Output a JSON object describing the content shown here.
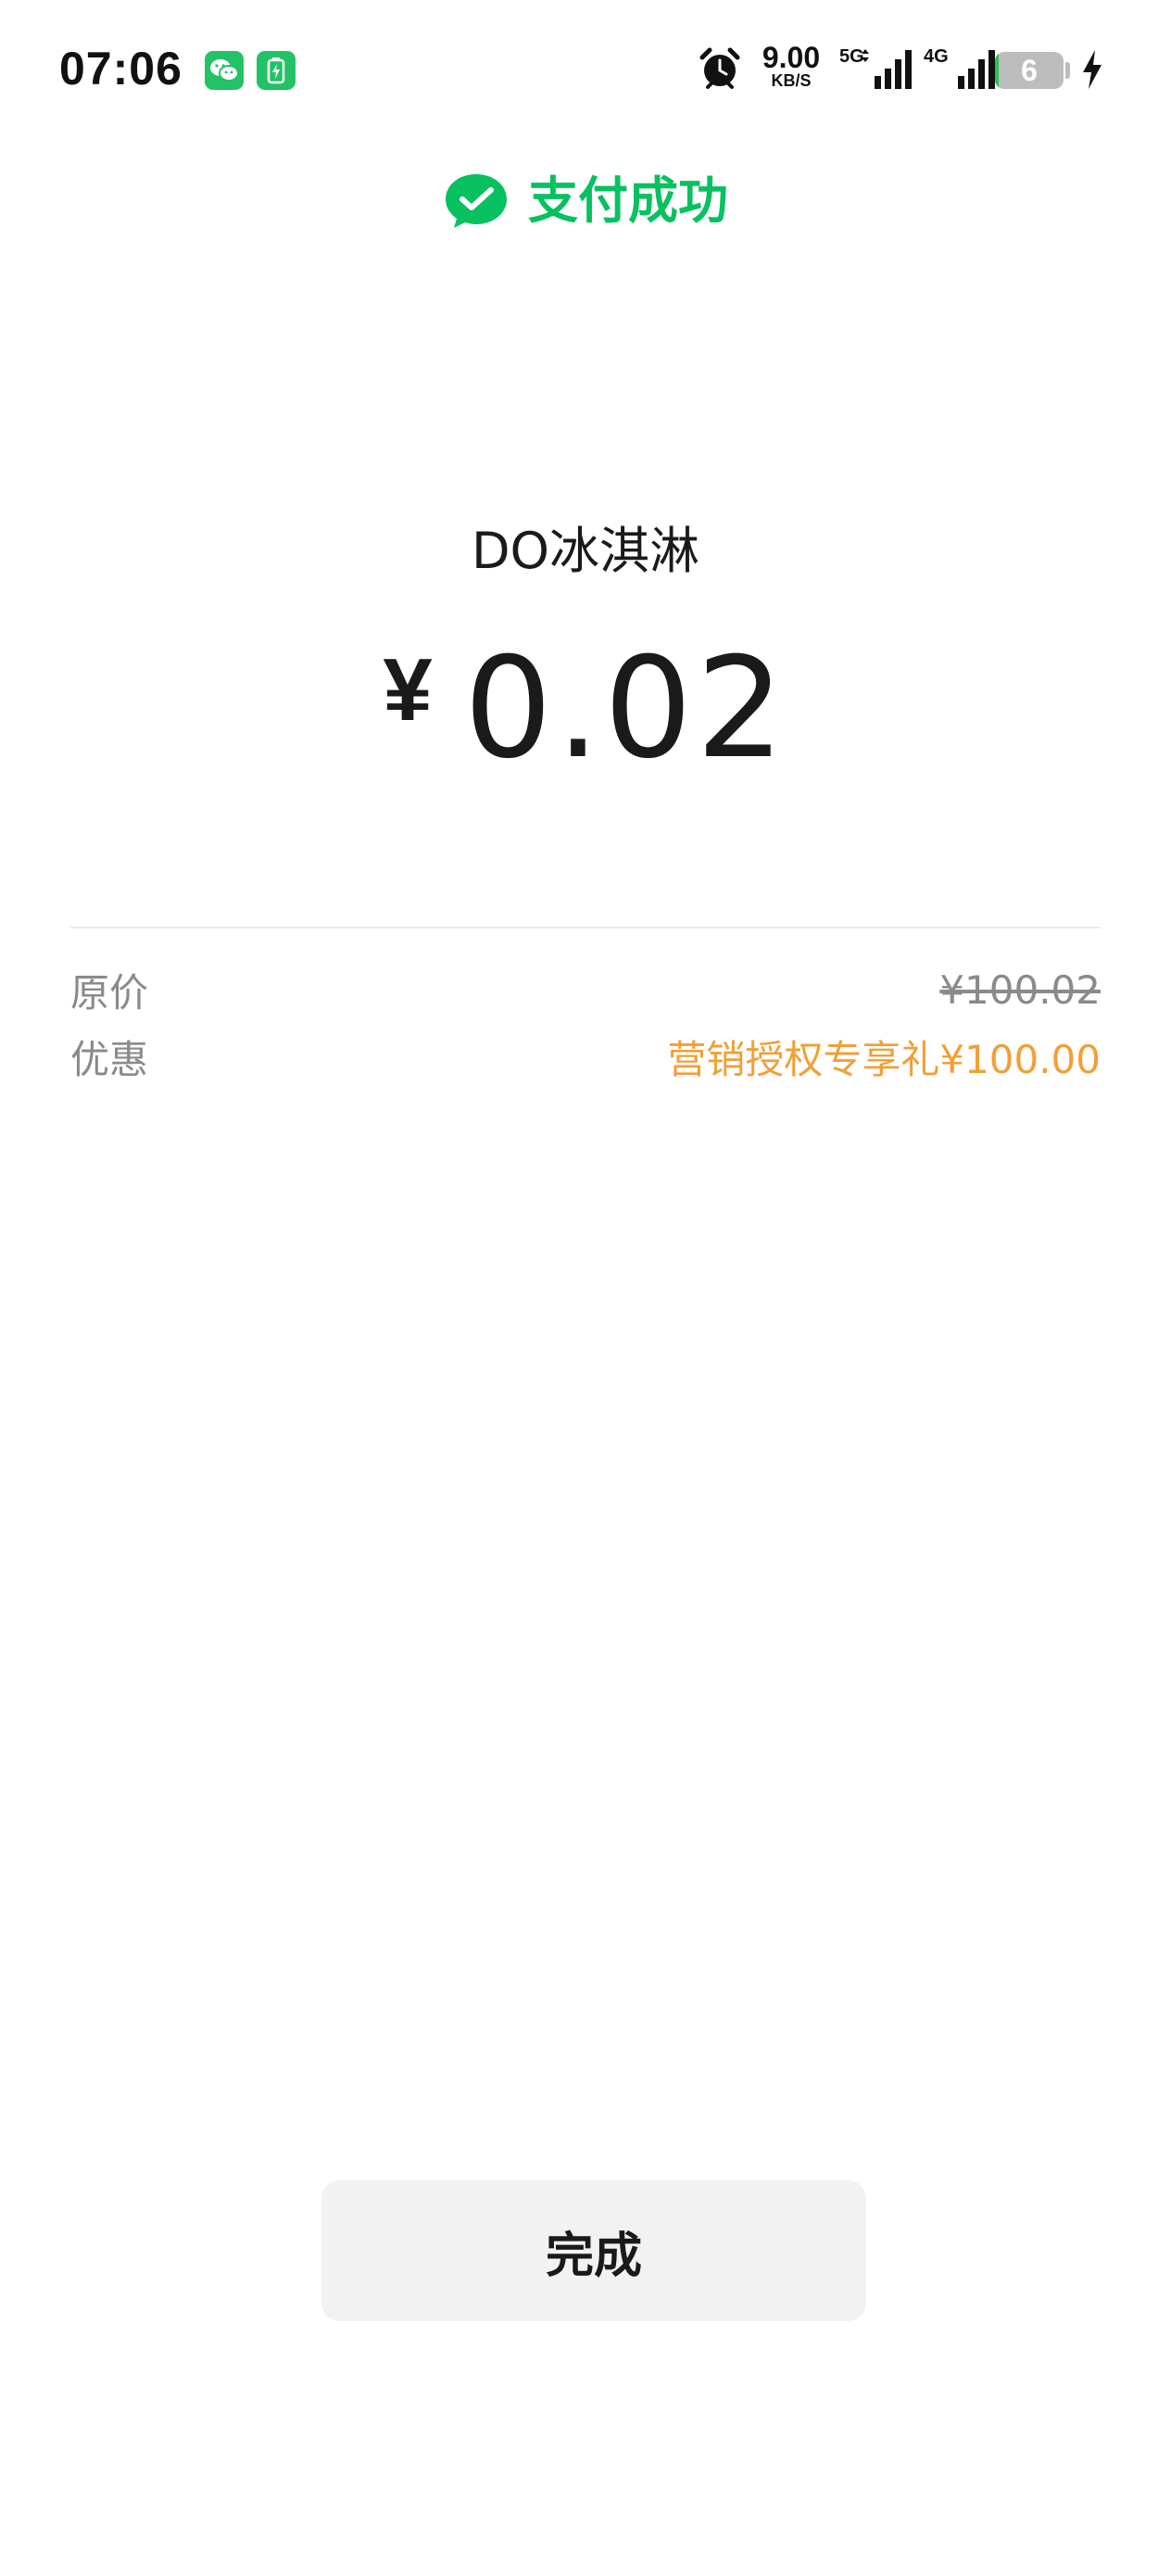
{
  "status_bar": {
    "time": "07:06",
    "net_speed_value": "9.00",
    "net_speed_unit": "KB/S",
    "signal_1_label": "5G",
    "signal_2_label": "4G",
    "battery_level": "6",
    "battery_fraction": 0.06,
    "icons": [
      "wechat-icon",
      "battery-saver-icon",
      "alarm-icon",
      "signal-icon",
      "charging-icon"
    ]
  },
  "header": {
    "status_text": "支付成功",
    "accent_color": "#07c160"
  },
  "payment": {
    "merchant": "DO冰淇淋",
    "currency_symbol": "¥",
    "amount": "0.02"
  },
  "details": {
    "original_label": "原价",
    "original_value": "¥100.02",
    "discount_label": "优惠",
    "discount_value": "营销授权专享礼¥100.00",
    "discount_color": "#f0a037"
  },
  "actions": {
    "done_label": "完成"
  }
}
